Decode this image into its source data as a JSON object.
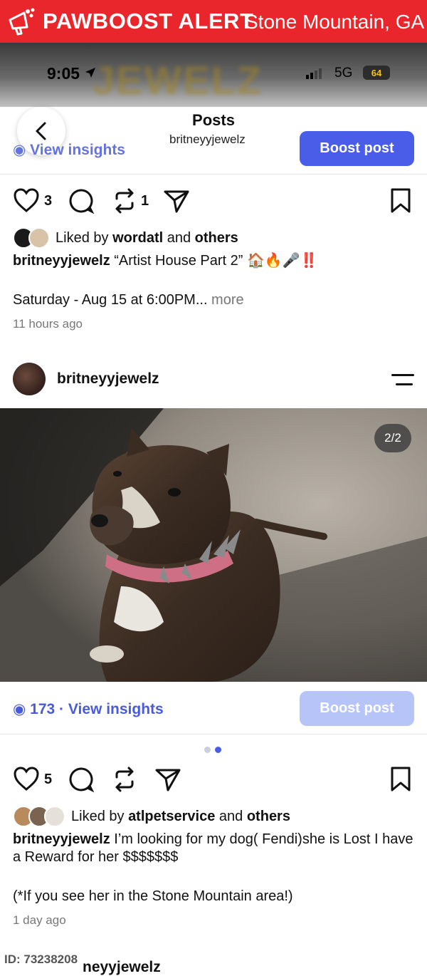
{
  "banner": {
    "brand": "PAWBOOST ALERT",
    "location": "Stone Mountain, GA"
  },
  "status_bar": {
    "time": "9:05",
    "network": "5G",
    "battery": "64",
    "background_text": "JEWELZ"
  },
  "top_nav": {
    "title": "Posts",
    "username": "britneyyjewelz",
    "insights_label": "View insights",
    "boost_label": "Boost post"
  },
  "post1": {
    "likes_count": "3",
    "reposts_count": "1",
    "liked_by_prefix": "Liked by ",
    "liked_by_user": "wordatl",
    "liked_by_and": " and ",
    "liked_by_others": "others",
    "caption_user": "britneyyjewelz",
    "caption_text": " “Artist House Part 2” 🏠🔥🎤‼️",
    "event_line": "Saturday - Aug 15 at 6:00PM...",
    "more_label": " more",
    "time_ago": "11 hours ago"
  },
  "post2": {
    "author": "britneyyjewelz",
    "image_counter": "2/2",
    "views_count": "173",
    "views_separator": " · ",
    "insights_label": "View insights",
    "boost_label": "Boost post",
    "likes_count": "5",
    "liked_by_prefix": "Liked by ",
    "liked_by_user": "atlpetservice",
    "liked_by_and": " and ",
    "liked_by_others": "others",
    "caption_user": "britneyyjewelz",
    "caption_text": " I’m looking for my dog( Fendi)she is Lost I have a Reward for her $$$$$$$",
    "caption_note": "(*If you see her in the Stone Mountain area!)",
    "time_ago": "1 day ago"
  },
  "next_post": {
    "author_partial": "neyyjewelz"
  },
  "watermark": "ID: 73238208",
  "colors": {
    "banner": "#e8262b",
    "accent": "#4a5de8",
    "accent_disabled": "#b7c4f7",
    "link": "#4a5bd9"
  }
}
